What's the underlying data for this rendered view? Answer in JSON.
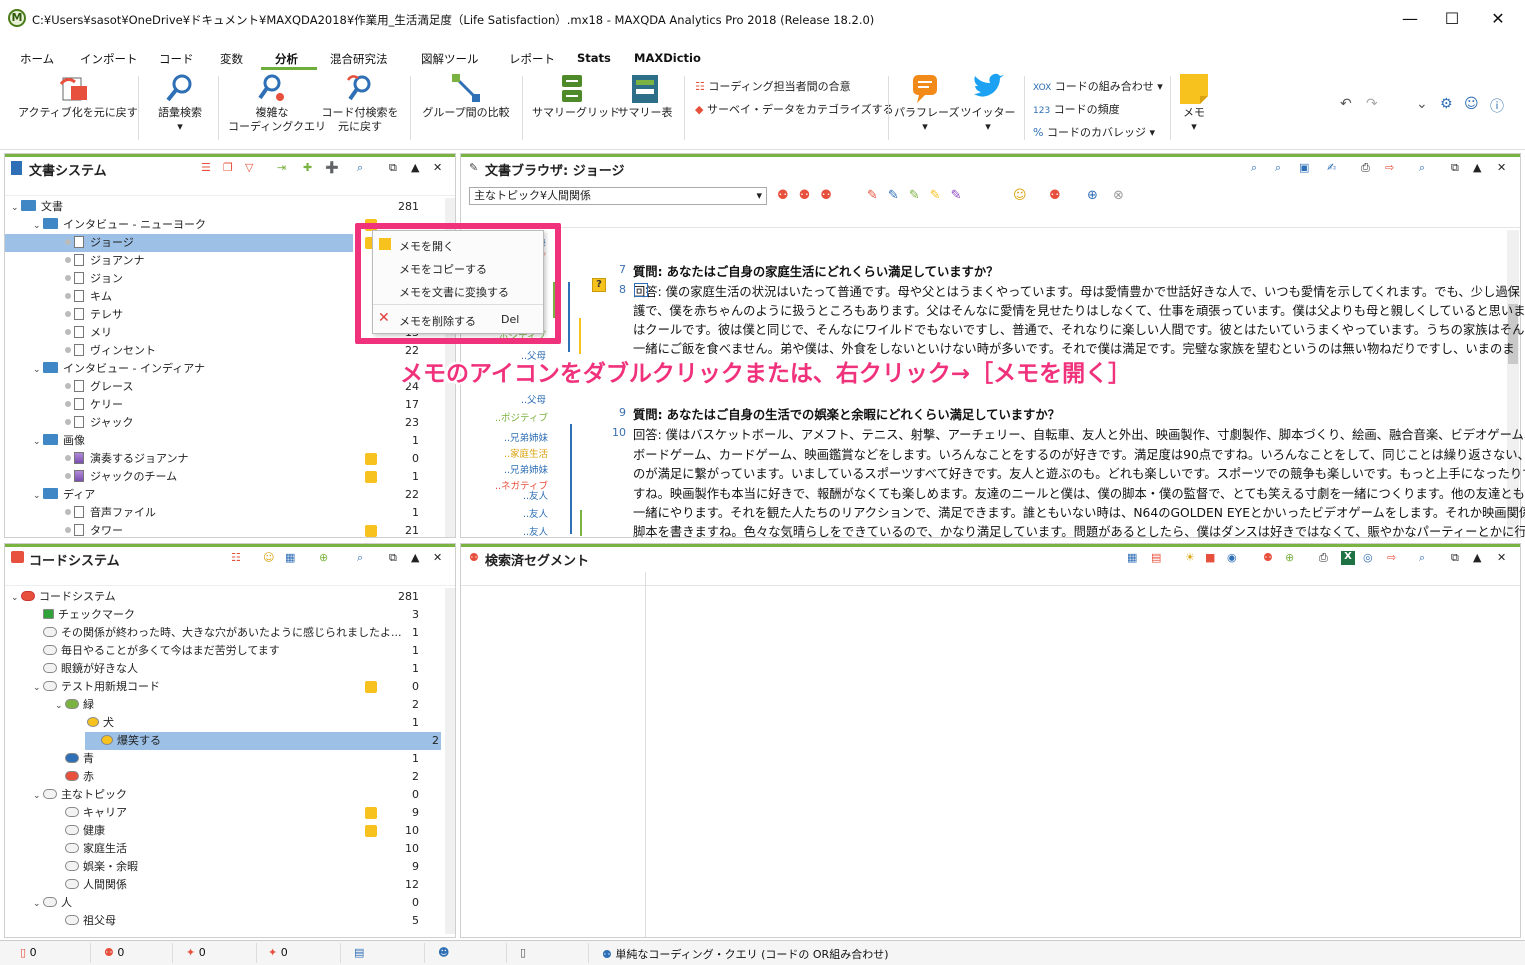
{
  "window": {
    "title": "C:¥Users¥sasot¥OneDrive¥ドキュメント¥MAXQDA2018¥作業用_生活満足度（Life Satisfaction）.mx18 - MAXQDA Analytics Pro 2018 (Release 18.2.0)",
    "logo": "M"
  },
  "ribbon_tabs": [
    "ホーム",
    "インポート",
    "コード",
    "変数",
    "分析",
    "混合研究法",
    "図解ツール",
    "レポート",
    "Stats",
    "MAXDictio"
  ],
  "ribbon": {
    "undo_activation": "アクティブ化を元に戻す",
    "lexical_search": "語彙検索",
    "complex_query_1": "複雑な",
    "complex_query_2": "コーディングクエリ",
    "undo_search_1": "コード付検索を",
    "undo_search_2": "元に戻す",
    "group_compare": "グループ間の比較",
    "summary_grid": "サマリーグリッド",
    "summary_table": "サマリー表",
    "intercoder": "コーディング担当者間の合意",
    "categorize_survey": "サーベイ・データをカテゴライズする",
    "paraphrase": "パラフレーズ",
    "twitter": "ツイッター",
    "code_combo": "コードの組み合わせ",
    "code_freq": "コードの頻度",
    "code_coverage": "コードのカバレッジ",
    "memo": "メモ"
  },
  "doc_system": {
    "title": "文書システム",
    "rows": [
      {
        "label": "文書",
        "count": "281",
        "level": 0,
        "type": "folder"
      },
      {
        "label": "インタビュー - ニューヨーク",
        "count": "",
        "level": 1,
        "type": "folder"
      },
      {
        "label": "ジョージ",
        "count": "",
        "level": 2,
        "type": "doc",
        "selected": true
      },
      {
        "label": "ジョアンナ",
        "count": "",
        "level": 2,
        "type": "doc"
      },
      {
        "label": "ジョン",
        "count": "",
        "level": 2,
        "type": "doc"
      },
      {
        "label": "キム",
        "count": "",
        "level": 2,
        "type": "doc"
      },
      {
        "label": "テレサ",
        "count": "",
        "level": 2,
        "type": "doc"
      },
      {
        "label": "メリ",
        "count": "13",
        "level": 2,
        "type": "doc"
      },
      {
        "label": "ヴィンセント",
        "count": "22",
        "level": 2,
        "type": "doc"
      },
      {
        "label": "インタビュー - インディアナ",
        "count": "",
        "level": 1,
        "type": "folder"
      },
      {
        "label": "グレース",
        "count": "24",
        "level": 2,
        "type": "doc"
      },
      {
        "label": "ケリー",
        "count": "17",
        "level": 2,
        "type": "doc"
      },
      {
        "label": "ジャック",
        "count": "23",
        "level": 2,
        "type": "doc"
      },
      {
        "label": "画像",
        "count": "1",
        "level": 1,
        "type": "folder"
      },
      {
        "label": "演奏するジョアンナ",
        "count": "0",
        "level": 2,
        "type": "img"
      },
      {
        "label": "ジャックのチーム",
        "count": "1",
        "level": 2,
        "type": "img"
      },
      {
        "label": "ディア",
        "count": "22",
        "level": 1,
        "type": "folder"
      },
      {
        "label": "音声ファイル",
        "count": "1",
        "level": 2,
        "type": "doc"
      },
      {
        "label": "タワー",
        "count": "21",
        "level": 2,
        "type": "doc"
      }
    ]
  },
  "code_system": {
    "title": "コードシステム",
    "rows": [
      {
        "label": "コードシステム",
        "count": "281",
        "level": 0
      },
      {
        "label": "チェックマーク",
        "count": "3",
        "level": 1
      },
      {
        "label": "その関係が終わった時、大きな穴があいたように感じられましたよ...",
        "count": "1",
        "level": 1
      },
      {
        "label": "毎日やることが多くて今はまだ苦労してます",
        "count": "1",
        "level": 1
      },
      {
        "label": "眼鏡が好きな人",
        "count": "1",
        "level": 1
      },
      {
        "label": "テスト用新規コード",
        "count": "0",
        "level": 1
      },
      {
        "label": "緑",
        "count": "2",
        "level": 2
      },
      {
        "label": "犬",
        "count": "1",
        "level": 3
      },
      {
        "label": "爆笑する",
        "count": "2",
        "level": 3,
        "selected": true
      },
      {
        "label": "青",
        "count": "1",
        "level": 2
      },
      {
        "label": "赤",
        "count": "2",
        "level": 2
      },
      {
        "label": "主なトピック",
        "count": "0",
        "level": 1
      },
      {
        "label": "キャリア",
        "count": "9",
        "level": 2
      },
      {
        "label": "健康",
        "count": "10",
        "level": 2
      },
      {
        "label": "家庭生活",
        "count": "10",
        "level": 2
      },
      {
        "label": "娯楽・余暇",
        "count": "9",
        "level": 2
      },
      {
        "label": "人間関係",
        "count": "12",
        "level": 2
      },
      {
        "label": "人",
        "count": "0",
        "level": 1
      },
      {
        "label": "祖父母",
        "count": "5",
        "level": 2
      }
    ]
  },
  "doc_browser": {
    "title": "文書ブラウザ: ジョージ",
    "code_dropdown": "主なトピック¥人間関係",
    "lines": [
      {
        "num": "7",
        "text": "質問: あなたはご自身の家庭生活にどれくらい満足していますか？",
        "bold": true
      },
      {
        "num": "8",
        "text": "回答: 僕の家庭生活の状況はいたって普通です。母や父とはうまくやっています。母は愛情豊かで世話好きな人で、いつも愛情を示してくれます。でも、少し過保",
        "bold": false
      },
      {
        "num": "",
        "text": "護で、僕を赤ちゃんのように扱うところもあります。父はそんなに愛情を見せたりはしなくて、仕事を頑張っています。僕は父よりも母と親しくしていると思います。弟",
        "bold": false
      },
      {
        "num": "",
        "text": "はクールです。彼は僕と同じで、そんなにワイルドでもないですし、普通で、それなりに楽しい人間です。彼とはたいていうまくやっています。うちの家族はそんなに",
        "bold": false
      },
      {
        "num": "",
        "text": "一緒にご飯を食べません。弟や僕は、外食をしないといけない時が多いです。それで僕は満足です。完璧な家族を望むというのは無い物ねだりですし、いまのま",
        "bold": false
      },
      {
        "num": "9",
        "text": "質問: あなたはご自身の生活での娯楽と余暇にどれくらい満足していますか？",
        "bold": true
      },
      {
        "num": "10",
        "text": "回答: 僕はバスケットボール、アメフト、テニス、射撃、アーチェリー、自転車、友人と外出、映画製作、寸劇製作、脚本づくり、絵画、融合音楽、ビデオゲーム、",
        "bold": false
      },
      {
        "num": "",
        "text": "ボードゲーム、カードゲーム、映画鑑賞などをします。いろんなことをするのが好きです。満足度は90点ですね。いろんなことをして、同じことは繰り返さない、という",
        "bold": false
      },
      {
        "num": "",
        "text": "のが満足に繋がっています。いましているスポーツすべて好きです。友人と遊ぶのも。どれも楽しいです。スポーツでの競争も楽しいです。もっと上手になったりで",
        "bold": false
      },
      {
        "num": "",
        "text": "すね。映画製作も本当に好きで、報酬がなくても楽しめます。友達のニールと僕は、僕の脚本・僕の監督で、とても笑える寸劇を一緒につくります。他の友達とも",
        "bold": false
      },
      {
        "num": "",
        "text": "一緒にやります。それを観た人たちのリアクションで、満足できます。誰ともいない時は、N64のGOLDEN EYEとかいったビデオゲームをします。それか映画関係の",
        "bold": false
      },
      {
        "num": "",
        "text": "脚本を書きますね。色々な気晴らしをできているので、かなり満足しています。問題があるとしたら、僕はダンスは好きではなくて、賑やかなパーティーとかに行く",
        "bold": false
      }
    ],
    "margin_codes": [
      "父母",
      "ネガティブ",
      "ポジティブ",
      "父母",
      "父母",
      "ポジティブ",
      "兄弟姉妹",
      "家庭生活",
      "兄弟姉妹",
      "ネガティブ",
      "友人",
      "友人",
      "友人"
    ]
  },
  "retrieved": {
    "title": "検索済セグメント"
  },
  "context_menu": {
    "items": [
      "メモを開く",
      "メモをコピーする",
      "メモを文書に変換する",
      "メモを削除する"
    ],
    "delete_shortcut": "Del"
  },
  "annotation": "メモのアイコンをダブルクリックまたは、右クリック→［メモを開く］",
  "status": {
    "c1": "0",
    "c2": "0",
    "c3": "0",
    "c4": "0",
    "query": "単純なコーディング・クエリ (コードの OR組み合わせ)"
  },
  "colors": {
    "accent": "#7bb342",
    "highlight": "#f0317b",
    "memo": "#f7c21d",
    "selection": "#9cc0e6"
  }
}
